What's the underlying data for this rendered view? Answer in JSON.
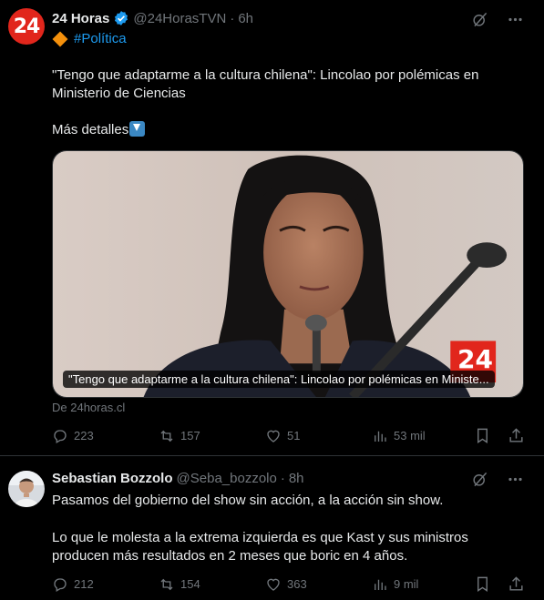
{
  "tweets": [
    {
      "avatar_text": "24",
      "name": "24 Horas",
      "handle": "@24HorasTVN",
      "dot": "·",
      "time": "6h",
      "hashtag": "#Política",
      "text_line1": "\"Tengo que adaptarme a la cultura chilena\": Lincolao por polémicas en Ministerio de Ciencias",
      "text_line2": "Más detalles",
      "card_caption": "\"Tengo que adaptarme a la cultura chilena\": Lincolao por polémicas en Ministe...",
      "card_logo": "24",
      "source": "De 24horas.cl",
      "replies": "223",
      "retweets": "157",
      "likes": "51",
      "views": "53 mil"
    },
    {
      "name": "Sebastian Bozzolo",
      "handle": "@Seba_bozzolo",
      "dot": "·",
      "time": "8h",
      "text_line1": "Pasamos del gobierno del show sin acción, a la acción sin show.",
      "text_line2": "Lo que le molesta a la extrema izquierda es que Kast y sus ministros producen más resultados en 2 meses que boric en 4 años.",
      "replies": "212",
      "retweets": "154",
      "likes": "363",
      "views": "9 mil"
    }
  ],
  "colors": {
    "background": "#000000",
    "text": "#e7e9ea",
    "muted": "#71767b",
    "accent": "#1d9bf0",
    "brand_red": "#e1261c"
  },
  "icons": [
    "verified-badge-icon",
    "grok-icon",
    "more-icon",
    "reply-icon",
    "retweet-icon",
    "like-icon",
    "views-icon",
    "bookmark-icon",
    "share-icon",
    "diamond-emoji-icon",
    "down-arrow-emoji-icon"
  ]
}
